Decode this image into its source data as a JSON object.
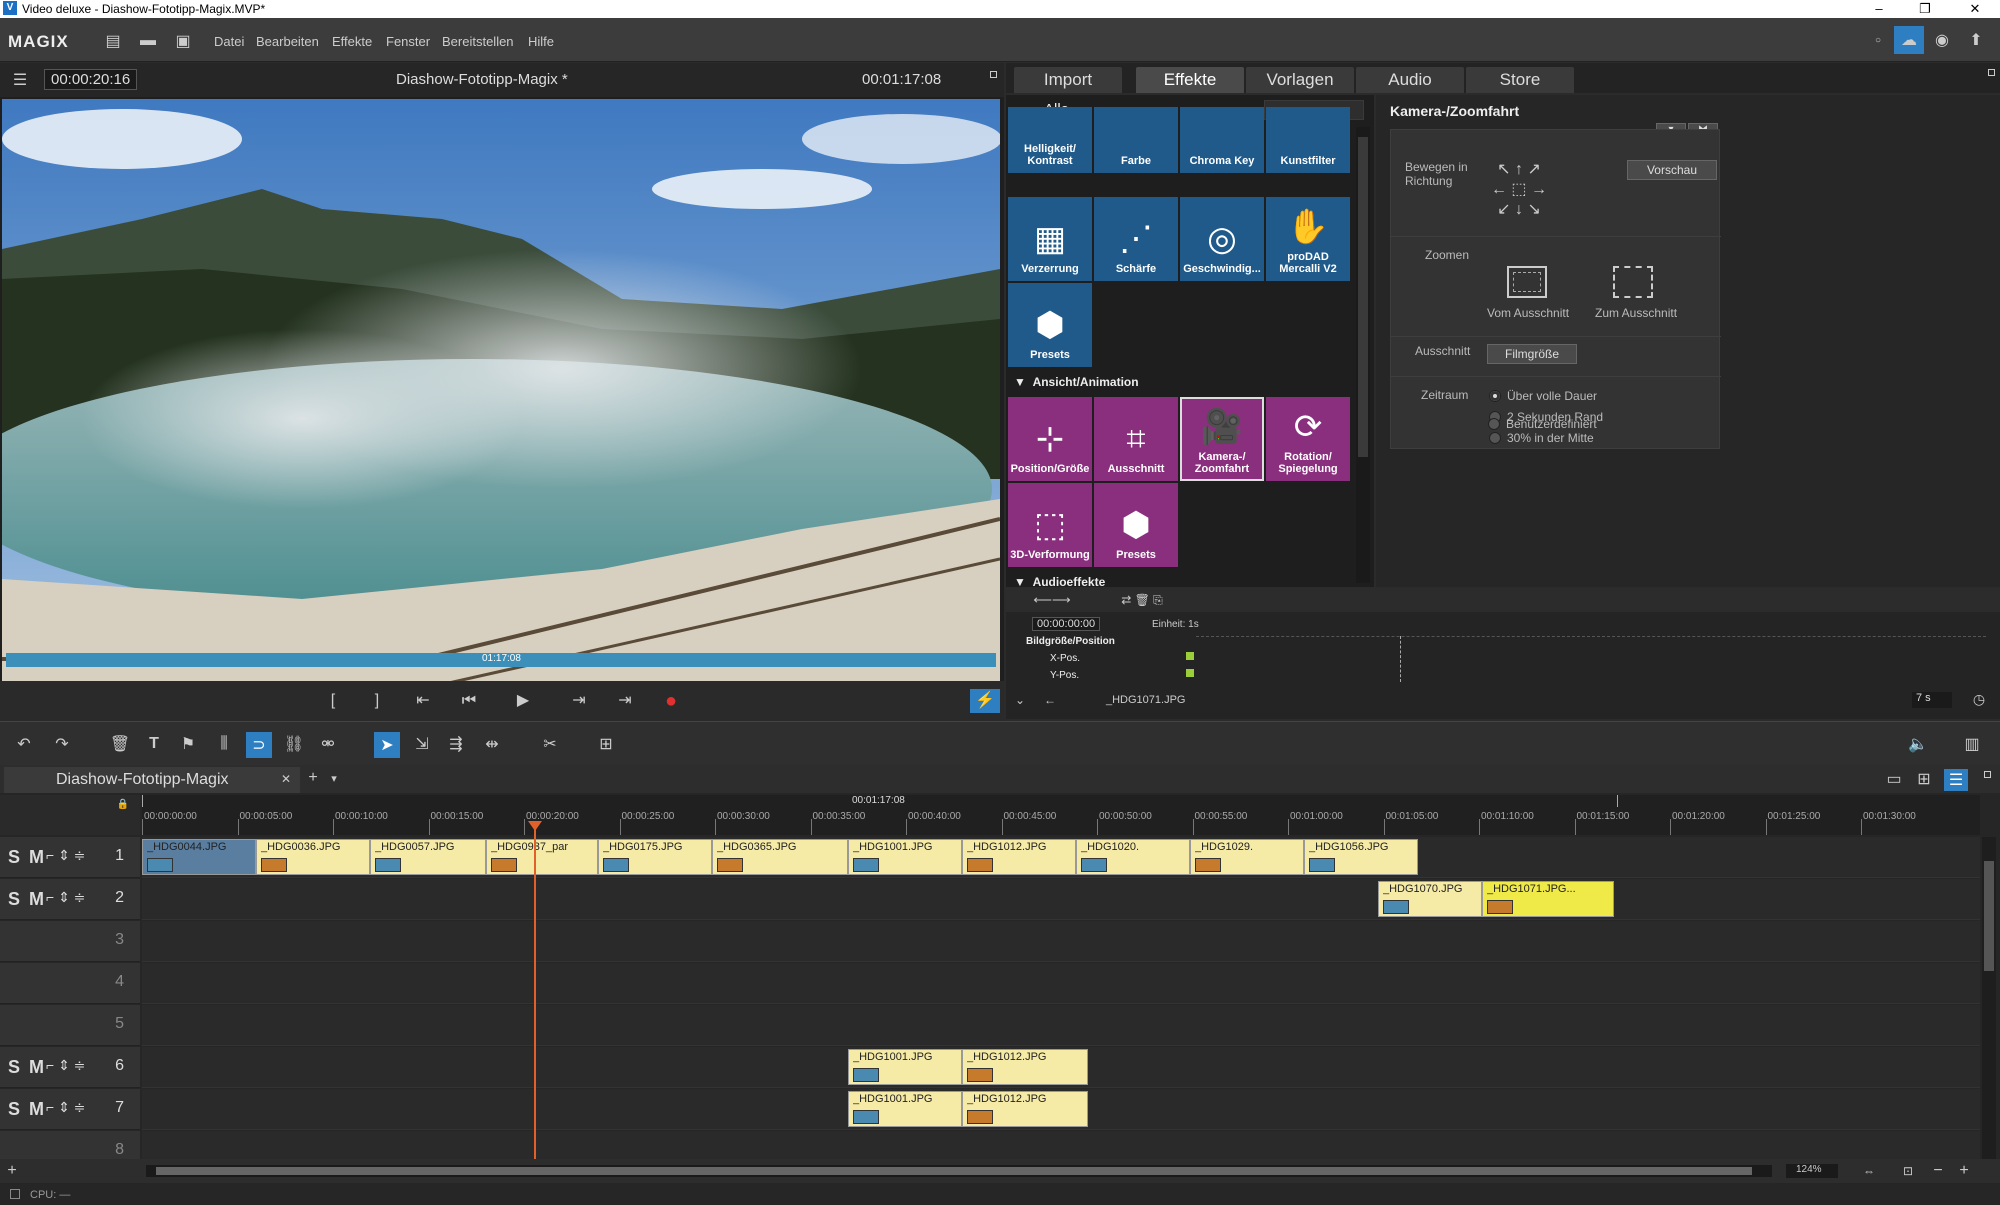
{
  "window": {
    "title": "Video deluxe - Diashow-Fototipp-Magix.MVP*"
  },
  "menubar": {
    "brand": "MAGIX",
    "items": [
      "Datei",
      "Bearbeiten",
      "Effekte",
      "Fenster",
      "Bereitstellen",
      "Hilfe"
    ]
  },
  "preview": {
    "timecode_current": "00:00:20:16",
    "project_name": "Diashow-Fototipp-Magix *",
    "timecode_total": "00:01:17:08",
    "scrub_label": "01:17:08"
  },
  "media_tabs": [
    "Import",
    "Effekte",
    "Vorlagen",
    "Audio",
    "Store"
  ],
  "effects": {
    "filter_label": "Alle",
    "image_tiles": [
      "Helligkeit/ Kontrast",
      "Farbe",
      "Chroma Key",
      "Kunstfilter",
      "Verzerrung",
      "Schärfe",
      "Geschwindig...",
      "proDAD Mercalli V2",
      "Presets"
    ],
    "section_animation": "Ansicht/Animation",
    "animation_tiles": [
      "Position/Größe",
      "Ausschnitt",
      "Kamera-/ Zoomfahrt",
      "Rotation/ Spiegelung",
      "3D-Verformung",
      "Presets"
    ],
    "section_audio": "Audioeffekte"
  },
  "settings": {
    "title": "Kamera-/Zoomfahrt",
    "move_label": "Bewegen in Richtung",
    "preview_button": "Vorschau",
    "zoom_label": "Zoomen",
    "zoom_from": "Vom Ausschnitt",
    "zoom_to": "Zum Ausschnitt",
    "crop_label": "Ausschnitt",
    "crop_button": "Filmgröße",
    "period_label": "Zeitraum",
    "period_options": [
      "Über volle Dauer",
      "2 Sekunden Rand",
      "30% in der Mitte",
      "Benutzerdefiniert"
    ]
  },
  "keyframes": {
    "timecode": "00:00:00:00",
    "unit": "Einheit: 1s",
    "rows": [
      "Bildgröße/Position",
      "X-Pos.",
      "Y-Pos."
    ],
    "file": "_HDG1071.JPG",
    "duration": "7 s"
  },
  "timeline": {
    "tab": "Diashow-Fototipp-Magix",
    "range_label": "00:01:17:08",
    "ruler": [
      "00:00:00:00",
      "00:00:05:00",
      "00:00:10:00",
      "00:00:15:00",
      "00:00:20:00",
      "00:00:25:00",
      "00:00:30:00",
      "00:00:35:00",
      "00:00:40:00",
      "00:00:45:00",
      "00:00:50:00",
      "00:00:55:00",
      "00:01:00:00",
      "00:01:05:00",
      "00:01:10:00",
      "00:01:15:00",
      "00:01:20:00",
      "00:01:25:00",
      "00:01:30:00"
    ],
    "tracks": [
      "1",
      "2",
      "3",
      "4",
      "5",
      "6",
      "7",
      "8"
    ],
    "track_controls": "S M",
    "track1": [
      "_HDG0044.JPG",
      "_HDG0036.JPG",
      "_HDG0057.JPG",
      "_HDG0937_par",
      "_HDG0175.JPG",
      "_HDG0365.JPG",
      "_HDG1001.JPG",
      "_HDG1012.JPG",
      "_HDG1020.",
      "_HDG1029.",
      "_HDG1056.JPG"
    ],
    "track2": [
      "_HDG1070.JPG",
      "_HDG1071.JPG..."
    ],
    "track6": [
      "_HDG1001.JPG",
      "_HDG1012.JPG"
    ],
    "track7": [
      "_HDG1001.JPG",
      "_HDG1012.JPG"
    ],
    "zoom": "124%"
  },
  "status": {
    "cpu": "CPU: —"
  }
}
